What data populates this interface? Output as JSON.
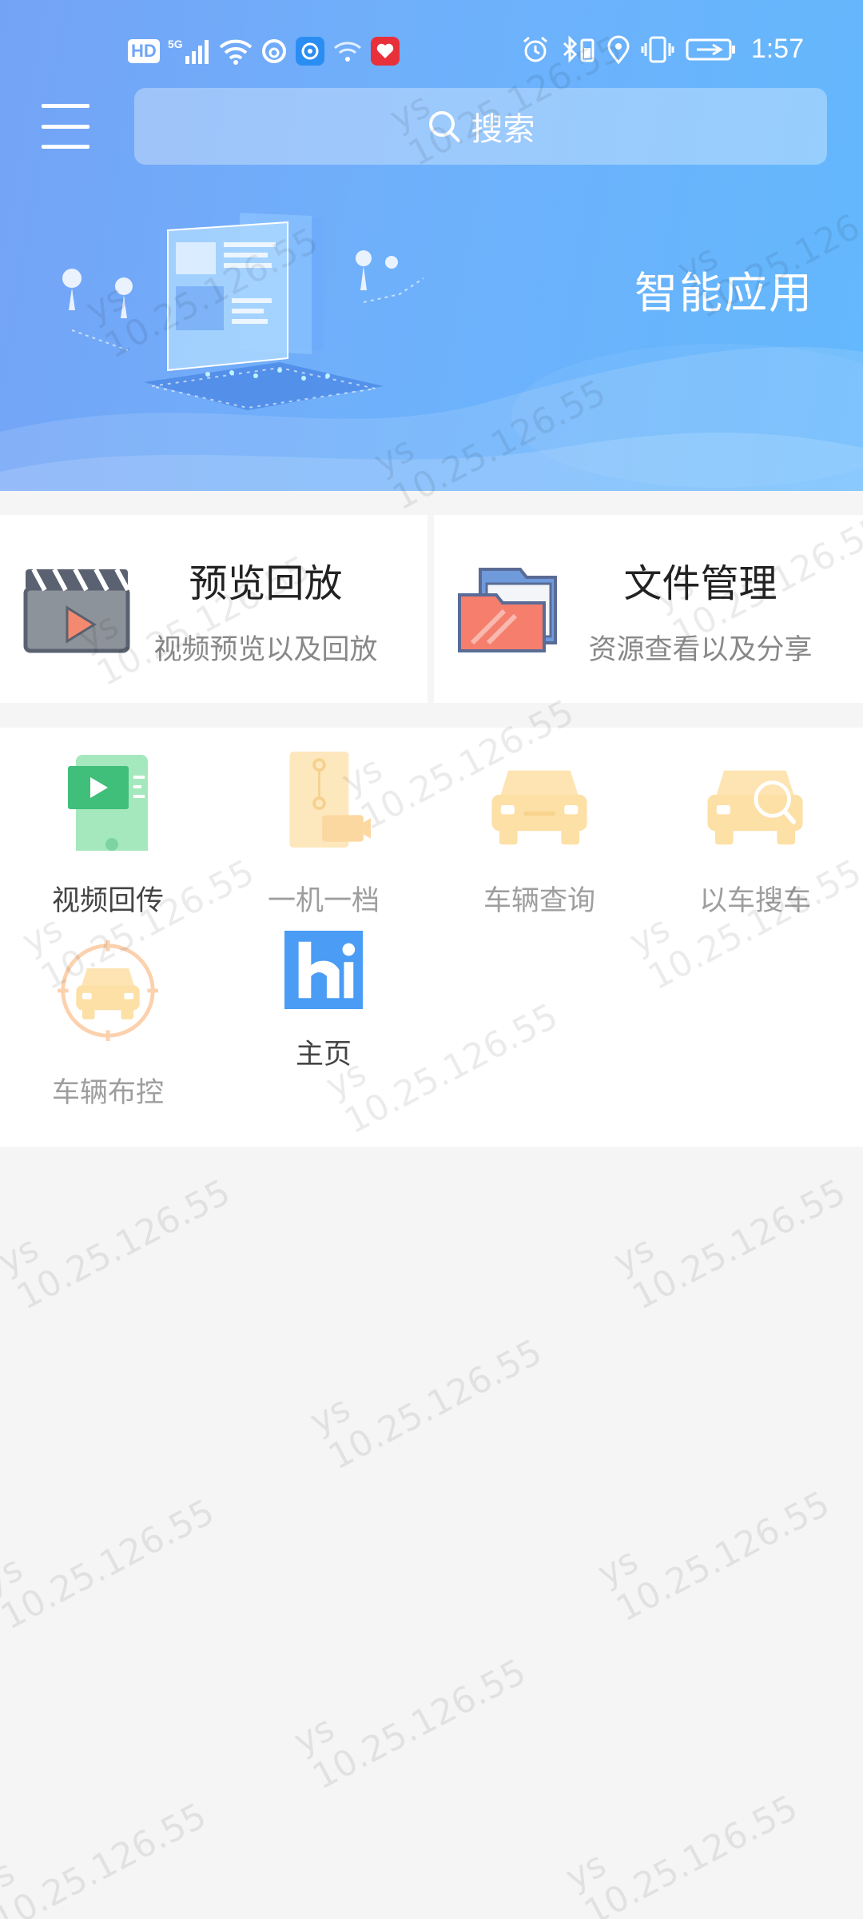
{
  "status_bar": {
    "network_badges": [
      "HD",
      "5G"
    ],
    "time": "1:57"
  },
  "header": {
    "search_placeholder": "搜索",
    "banner_title": "智能应用"
  },
  "feature_cards": [
    {
      "title": "预览回放",
      "subtitle": "视频预览以及回放",
      "icon": "clapperboard-icon"
    },
    {
      "title": "文件管理",
      "subtitle": "资源查看以及分享",
      "icon": "folder-icon"
    }
  ],
  "apps": [
    {
      "label": "视频回传",
      "icon": "phone-video-icon",
      "enabled": true
    },
    {
      "label": "一机一档",
      "icon": "archive-icon",
      "enabled": false
    },
    {
      "label": "车辆查询",
      "icon": "car-icon",
      "enabled": false
    },
    {
      "label": "以车搜车",
      "icon": "car-search-icon",
      "enabled": false
    },
    {
      "label": "车辆布控",
      "icon": "car-target-icon",
      "enabled": false
    },
    {
      "label": "主页",
      "icon": "hi-logo-icon",
      "enabled": true
    }
  ],
  "watermark": {
    "user": "ys",
    "ip": "10.25.126.55"
  },
  "colors": {
    "header_start": "#74a3f6",
    "header_end": "#63b8fd",
    "car_yellow": "#fde0a6",
    "video_green": "#8fe0a8",
    "hi_blue": "#4a9cf5"
  }
}
